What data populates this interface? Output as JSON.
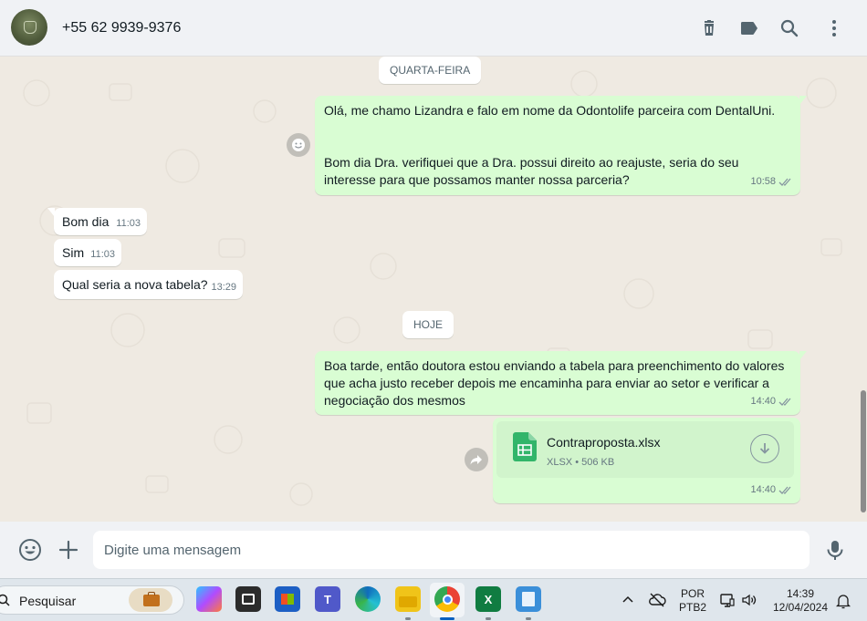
{
  "header": {
    "contact_name": "+55 62 9939-9376",
    "icons": [
      "delete-icon",
      "label-icon",
      "search-icon",
      "menu-icon"
    ]
  },
  "chat": {
    "date_chip_1": "QUARTA-FEIRA",
    "date_chip_2": "HOJE",
    "messages": [
      {
        "direction": "out",
        "line1": "Olá, me chamo Lizandra e falo em nome da Odontolife parceira com DentalUni.",
        "line2": "Bom dia Dra. verifiquei que a Dra. possui direito ao reajuste, seria do seu interesse para que possamos manter nossa parceria?",
        "time": "10:58"
      },
      {
        "direction": "in",
        "text": "Bom dia",
        "time": "11:03"
      },
      {
        "direction": "in",
        "text": "Sim",
        "time": "11:03"
      },
      {
        "direction": "in",
        "text": "Qual seria a nova tabela?",
        "time": "13:29"
      },
      {
        "direction": "out",
        "text": "Boa tarde, então doutora estou enviando a tabela para preenchimento do valores que acha justo receber depois me encaminha para enviar ao setor e verificar a negociação dos mesmos",
        "time": "14:40"
      },
      {
        "direction": "out",
        "file_name": "Contraproposta.xlsx",
        "file_type": "XLSX",
        "file_size": "506 KB",
        "separator": "•",
        "time": "14:40"
      }
    ]
  },
  "compose": {
    "placeholder": "Digite uma mensagem",
    "icons": [
      "emoji-icon",
      "plus-icon",
      "microphone-icon"
    ]
  },
  "taskbar": {
    "search_label": "Pesquisar",
    "language": "POR",
    "layout": "PTB2",
    "time": "14:39",
    "date": "12/04/2024"
  },
  "colors": {
    "outgoing_bubble": "#d9fdd3",
    "incoming_bubble": "#ffffff",
    "chat_background": "#efeae2",
    "header_background": "#f0f2f5",
    "ticks": "#8696a0"
  }
}
